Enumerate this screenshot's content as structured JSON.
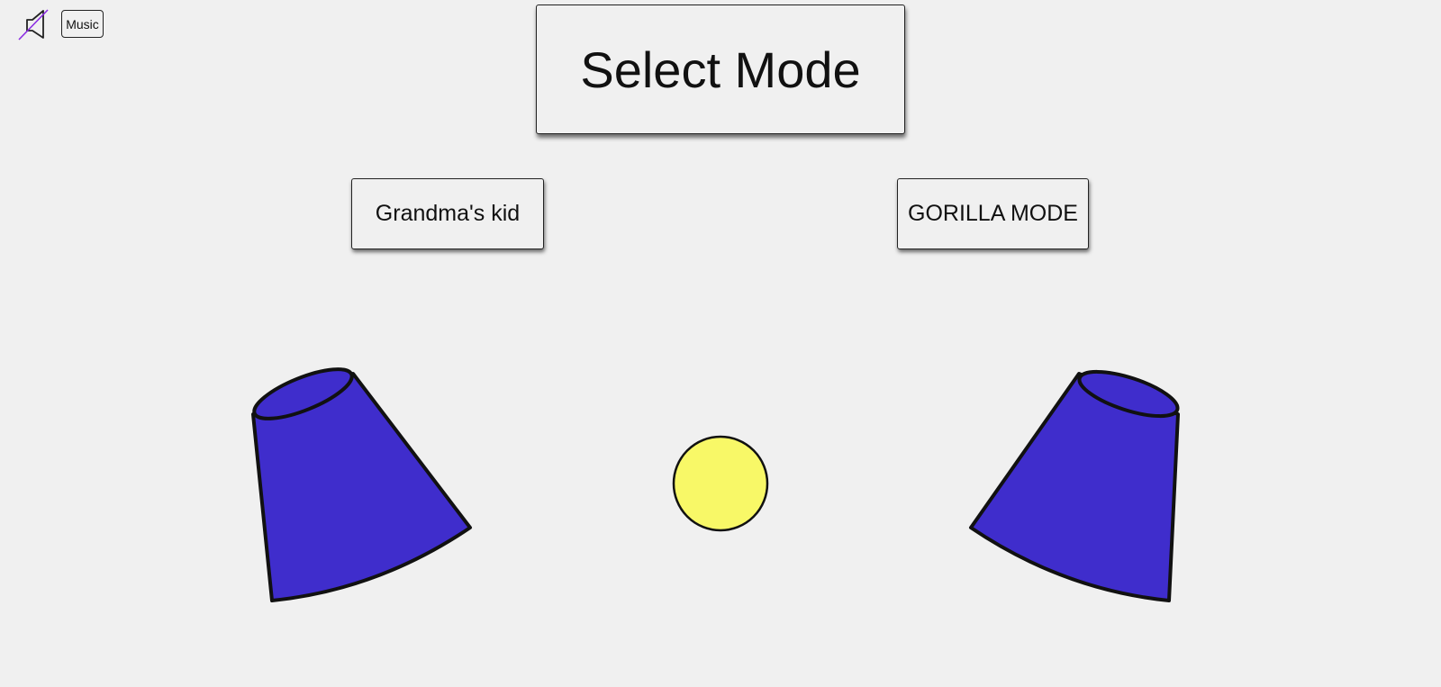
{
  "audio": {
    "mute_icon": "speaker-muted-icon",
    "music_label": "Music"
  },
  "title": "Select Mode",
  "modes": [
    {
      "label": "Grandma's kid"
    },
    {
      "label": "GORILLA MODE"
    }
  ],
  "scene": {
    "cup_color": "#3f2dcc",
    "ball_color": "#f8f867",
    "cup_count": 2,
    "ball_count": 1
  }
}
